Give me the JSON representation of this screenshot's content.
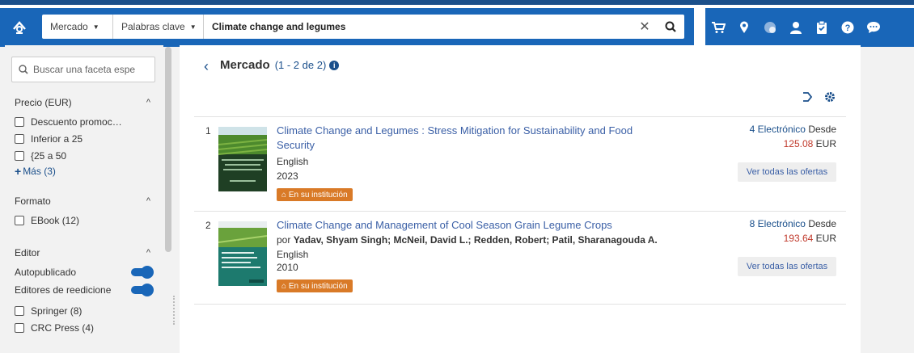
{
  "header": {
    "scope_label": "Mercado",
    "field_label": "Palabras clave",
    "query": "Climate change and legumes",
    "icons": [
      "cart-icon",
      "location-icon",
      "globe-icon",
      "user-icon",
      "clipboard-icon",
      "help-icon",
      "chat-icon"
    ]
  },
  "sidebar": {
    "facet_search_placeholder": "Buscar una faceta espe",
    "groups": [
      {
        "title": "Precio (EUR)",
        "items": [
          "Descuento promoc…",
          "Inferior a 25",
          "{25 a 50"
        ],
        "more": "Más (3)"
      },
      {
        "title": "Formato",
        "items": [
          "EBook (12)"
        ]
      },
      {
        "title": "Editor",
        "toggles": [
          "Autopublicado",
          "Editores de reedicione"
        ],
        "items": [
          "Springer (8)",
          "CRC Press (4)"
        ]
      }
    ]
  },
  "main": {
    "title": "Mercado",
    "count": "(1 - 2 de 2)",
    "results": [
      {
        "num": "1",
        "title": "Climate Change and Legumes : Stress Mitigation for Sustainability and Food Security",
        "authors_prefix": "",
        "authors": "",
        "language": "English",
        "year": "2023",
        "badge": "En su institución",
        "offer_count": "4 Electrónico",
        "from": "Desde",
        "price": "125.08",
        "currency": "EUR",
        "offers_button": "Ver todas las ofertas"
      },
      {
        "num": "2",
        "title": "Climate Change and Management of Cool Season Grain Legume Crops",
        "authors_prefix": "por",
        "authors": "Yadav, Shyam Singh; McNeil, David L.; Redden, Robert; Patil, Sharanagouda A.",
        "language": "English",
        "year": "2010",
        "badge": "En su institución",
        "offer_count": "8 Electrónico",
        "from": "Desde",
        "price": "193.64",
        "currency": "EUR",
        "offers_button": "Ver todas las ofertas"
      }
    ]
  },
  "colors": {
    "brand": "#1966b8",
    "link": "#3a5fa6",
    "badge": "#d97a27",
    "price": "#c0392b"
  }
}
